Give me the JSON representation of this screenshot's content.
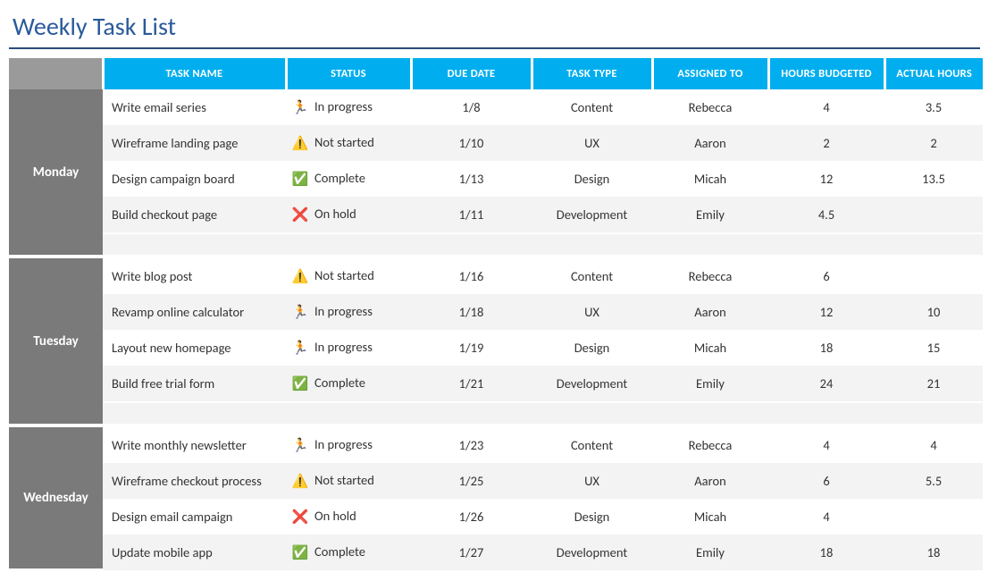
{
  "title": "Weekly Task List",
  "headers": {
    "task_name": "TASK NAME",
    "status": "STATUS",
    "due_date": "DUE DATE",
    "task_type": "TASK TYPE",
    "assigned_to": "ASSIGNED TO",
    "hours_budgeted": "HOURS BUDGETED",
    "actual_hours": "ACTUAL HOURS"
  },
  "status_labels": {
    "in_progress": "In progress",
    "not_started": "Not started",
    "complete": "Complete",
    "on_hold": "On hold"
  },
  "status_icons": {
    "in_progress": "🏃",
    "not_started": "⚠️",
    "complete": "✅",
    "on_hold": "❌"
  },
  "days": [
    {
      "name": "Monday",
      "tasks": [
        {
          "task": "Write email series",
          "status": "in_progress",
          "due": "1/8",
          "type": "Content",
          "assigned": "Rebecca",
          "budget": "4",
          "actual": "3.5"
        },
        {
          "task": "Wireframe landing page",
          "status": "not_started",
          "due": "1/10",
          "type": "UX",
          "assigned": "Aaron",
          "budget": "2",
          "actual": "2"
        },
        {
          "task": "Design campaign board",
          "status": "complete",
          "due": "1/13",
          "type": "Design",
          "assigned": "Micah",
          "budget": "12",
          "actual": "13.5"
        },
        {
          "task": "Build checkout page",
          "status": "on_hold",
          "due": "1/11",
          "type": "Development",
          "assigned": "Emily",
          "budget": "4.5",
          "actual": ""
        }
      ]
    },
    {
      "name": "Tuesday",
      "tasks": [
        {
          "task": "Write blog post",
          "status": "not_started",
          "due": "1/16",
          "type": "Content",
          "assigned": "Rebecca",
          "budget": "6",
          "actual": ""
        },
        {
          "task": "Revamp online calculator",
          "status": "in_progress",
          "due": "1/18",
          "type": "UX",
          "assigned": "Aaron",
          "budget": "12",
          "actual": "10"
        },
        {
          "task": "Layout new homepage",
          "status": "in_progress",
          "due": "1/19",
          "type": "Design",
          "assigned": "Micah",
          "budget": "18",
          "actual": "15"
        },
        {
          "task": "Build free trial form",
          "status": "complete",
          "due": "1/21",
          "type": "Development",
          "assigned": "Emily",
          "budget": "24",
          "actual": "21"
        }
      ]
    },
    {
      "name": "Wednesday",
      "tasks": [
        {
          "task": "Write monthly newsletter",
          "status": "in_progress",
          "due": "1/23",
          "type": "Content",
          "assigned": "Rebecca",
          "budget": "4",
          "actual": "4"
        },
        {
          "task": "Wireframe checkout process",
          "status": "not_started",
          "due": "1/25",
          "type": "UX",
          "assigned": "Aaron",
          "budget": "6",
          "actual": "5.5"
        },
        {
          "task": "Design email campaign",
          "status": "on_hold",
          "due": "1/26",
          "type": "Design",
          "assigned": "Micah",
          "budget": "4",
          "actual": ""
        },
        {
          "task": "Update mobile app",
          "status": "complete",
          "due": "1/27",
          "type": "Development",
          "assigned": "Emily",
          "budget": "18",
          "actual": "18"
        }
      ]
    }
  ]
}
